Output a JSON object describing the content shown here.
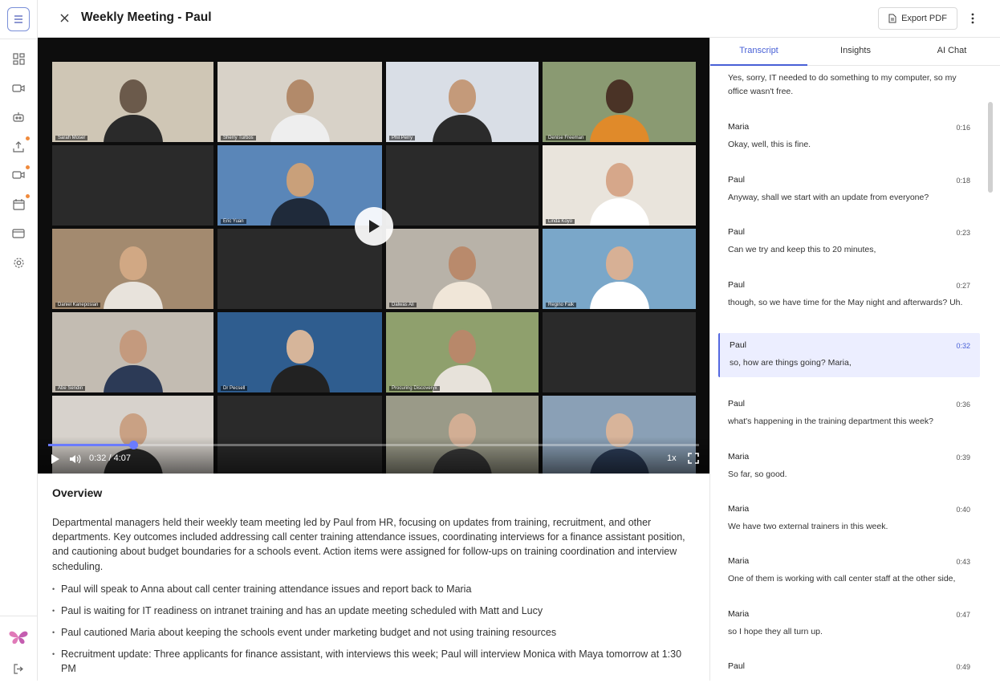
{
  "header": {
    "title": "Weekly Meeting - Paul",
    "export_label": "Export PDF"
  },
  "video": {
    "participants": [
      "Sarah Moser",
      "Sherry Turbos",
      "Phil Perry",
      "Denise Freeman",
      "",
      "Eric Yuan",
      "",
      "Linda Koyo",
      "Daniel Kaneposian",
      "",
      "Dalwas Ali",
      "Regino Falk",
      "Abe Sendin",
      "Dr Pecsell",
      "Procuring Discoveryx",
      "",
      "",
      "",
      "",
      ""
    ],
    "active_speaker_index": 1,
    "time": "0:32 / 4:07",
    "speed": "1x",
    "progress_fraction": 0.131
  },
  "overview": {
    "heading": "Overview",
    "summary": "Departmental managers held their weekly team meeting led by Paul from HR, focusing on updates from training, recruitment, and other departments. Key outcomes included addressing call center training attendance issues, coordinating interviews for a finance assistant position, and cautioning about budget boundaries for a schools event. Action items were assigned for follow-ups on training coordination and interview scheduling.",
    "bullets": [
      "Paul will speak to Anna about call center training attendance issues and report back to Maria",
      "Paul is waiting for IT readiness on intranet training and has an update meeting scheduled with Matt and Lucy",
      "Paul cautioned Maria about keeping the schools event under marketing budget and not using training resources",
      "Recruitment update: Three applicants for finance assistant, with interviews this week; Paul will interview Monica with Maya tomorrow at 1:30 PM"
    ]
  },
  "panel": {
    "tabs": [
      "Transcript",
      "Insights",
      "AI Chat"
    ],
    "active_tab": "Transcript",
    "transcript": [
      {
        "speaker": "",
        "time": "",
        "text": "Yes, sorry, IT needed to do something to my computer, so my office wasn't free."
      },
      {
        "speaker": "Maria",
        "time": "0:16",
        "text": "Okay, well, this is fine."
      },
      {
        "speaker": "Paul",
        "time": "0:18",
        "text": "Anyway, shall we start with an update from everyone?"
      },
      {
        "speaker": "Paul",
        "time": "0:23",
        "text": "Can we try and keep this to 20 minutes,"
      },
      {
        "speaker": "Paul",
        "time": "0:27",
        "text": "though, so we have time for the May night and afterwards? Uh."
      },
      {
        "speaker": "Paul",
        "time": "0:32",
        "text": "so, how are things going? Maria,"
      },
      {
        "speaker": "Paul",
        "time": "0:36",
        "text": "what's happening in the training department this week?"
      },
      {
        "speaker": "Maria",
        "time": "0:39",
        "text": "So far, so good."
      },
      {
        "speaker": "Maria",
        "time": "0:40",
        "text": "We have two external trainers in this week."
      },
      {
        "speaker": "Maria",
        "time": "0:43",
        "text": "One of them is working with call center staff at the other side,"
      },
      {
        "speaker": "Maria",
        "time": "0:47",
        "text": "so I hope they all turn up."
      },
      {
        "speaker": "Paul",
        "time": "0:49",
        "text": ""
      }
    ],
    "active_entry_index": 5
  },
  "colors": {
    "accent": "#4860d6",
    "highlight_bg": "#eceeff",
    "notification_dot": "#f08a3c"
  }
}
